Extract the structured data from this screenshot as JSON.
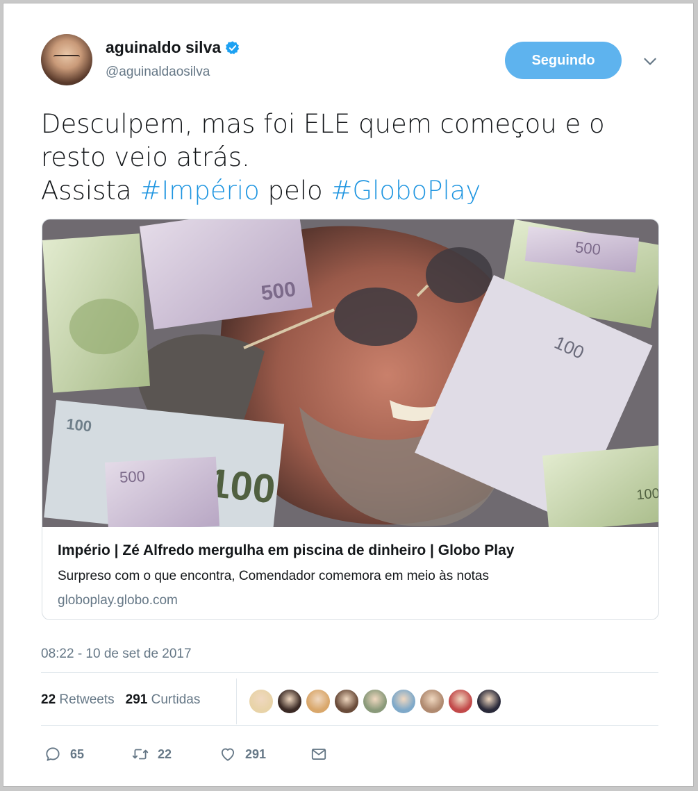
{
  "author": {
    "name": "aguinaldo silva",
    "handle": "@aguinaldaosilva",
    "verified": true
  },
  "follow_button": {
    "label": "Seguindo"
  },
  "tweet": {
    "line1": "Desculpem, mas foi ELE quem começou e o",
    "line2": "resto veio atrás.",
    "line3_prefix": "Assista ",
    "hashtag1": "#Império",
    "line3_mid": " pelo ",
    "hashtag2": "#GloboPlay"
  },
  "card": {
    "title": "Império | Zé Alfredo mergulha em piscina de dinheiro | Globo Play",
    "description": "Surpreso com o que encontra, Comendador comemora em meio às notas",
    "domain": "globoplay.globo.com",
    "image_banknote_values": [
      "500",
      "500",
      "100",
      "100",
      "500",
      "100",
      "100",
      "500",
      "100"
    ]
  },
  "timestamp": "08:22 - 10 de set de 2017",
  "stats": {
    "retweets_count": "22",
    "retweets_label": "Retweets",
    "likes_count": "291",
    "likes_label": "Curtidas"
  },
  "likers": [
    "#e8d3a8",
    "#3b2a25",
    "#d9a76b",
    "#6a4c3a",
    "#8a9a7a",
    "#7fa9c9",
    "#b08a70",
    "#c24a4a",
    "#2a2a3a"
  ],
  "actions": {
    "reply_count": "65",
    "retweet_count": "22",
    "like_count": "291"
  },
  "colors": {
    "accent": "#1c94e0",
    "button": "#5eb3ee",
    "muted": "#657786",
    "verified": "#1da1f2"
  },
  "icons": [
    "verified-badge-icon",
    "chevron-down-icon",
    "reply-icon",
    "retweet-icon",
    "like-icon",
    "message-icon"
  ]
}
